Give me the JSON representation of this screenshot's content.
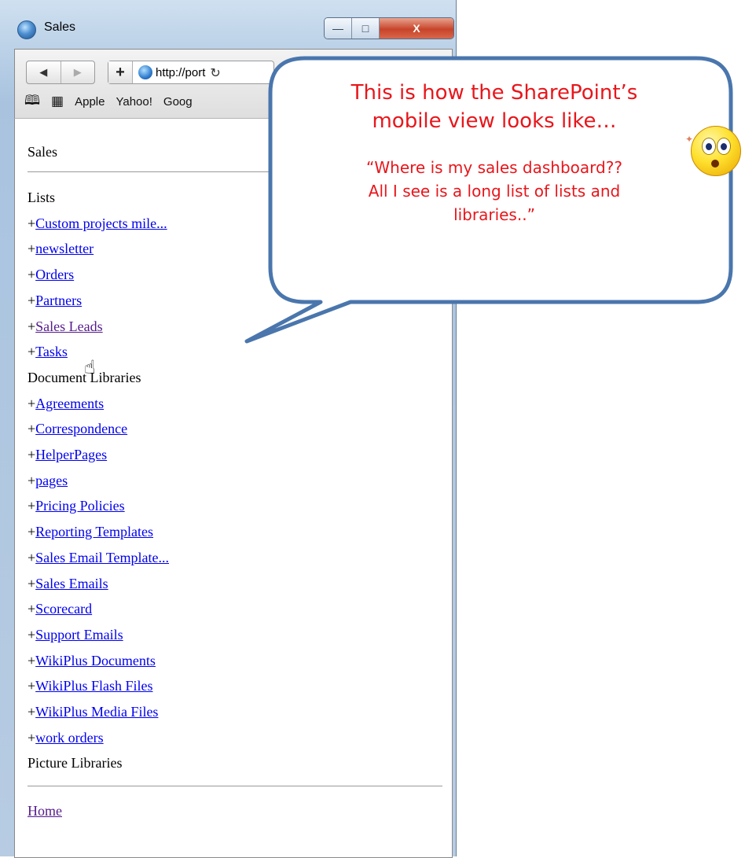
{
  "window": {
    "title": "Sales",
    "controls": {
      "minimize": "—",
      "maximize": "□",
      "close": "X"
    }
  },
  "toolbar": {
    "back": "◀",
    "forward": "▶",
    "add": "+",
    "url": "http://port",
    "reload": "↻",
    "bookmarks": [
      "Apple",
      "Yahoo!",
      "Goog"
    ],
    "bookmark_icons": [
      "book-icon",
      "grid-icon"
    ]
  },
  "page": {
    "site_title": "Sales",
    "lists_heading": "Lists",
    "lists": [
      {
        "prefix": "+",
        "label": "Custom projects mile...",
        "visited": false
      },
      {
        "prefix": "+",
        "label": "newsletter",
        "visited": false
      },
      {
        "prefix": "+",
        "label": "Orders",
        "visited": false
      },
      {
        "prefix": "+",
        "label": "Partners",
        "visited": false
      },
      {
        "prefix": "+",
        "label": "Sales Leads",
        "visited": true
      },
      {
        "prefix": "+",
        "label": "Tasks",
        "visited": false
      }
    ],
    "doclib_heading": "Document Libraries",
    "doclibs": [
      {
        "prefix": "+",
        "label": "Agreements",
        "visited": false
      },
      {
        "prefix": "+",
        "label": "Correspondence",
        "visited": false
      },
      {
        "prefix": "+",
        "label": "HelperPages",
        "visited": false
      },
      {
        "prefix": "+",
        "label": "pages",
        "visited": false
      },
      {
        "prefix": "+",
        "label": "Pricing Policies",
        "visited": false
      },
      {
        "prefix": "+",
        "label": "Reporting Templates",
        "visited": false
      },
      {
        "prefix": "+",
        "label": "Sales Email Template...",
        "visited": false
      },
      {
        "prefix": "+",
        "label": "Sales Emails",
        "visited": false
      },
      {
        "prefix": "+",
        "label": "Scorecard",
        "visited": false
      },
      {
        "prefix": "+",
        "label": "Support Emails",
        "visited": false
      },
      {
        "prefix": "+",
        "label": "WikiPlus Documents",
        "visited": false
      },
      {
        "prefix": "+",
        "label": "WikiPlus Flash Files",
        "visited": false
      },
      {
        "prefix": "+",
        "label": "WikiPlus Media Files",
        "visited": false
      },
      {
        "prefix": "+",
        "label": "work orders",
        "visited": false
      }
    ],
    "piclib_heading": "Picture Libraries",
    "home_link": "Home"
  },
  "callout": {
    "main_line1": "This is how the SharePoint’s",
    "main_line2": "mobile view looks like…",
    "quote_line1": "“Where is my sales dashboard??",
    "quote_line2": "All I see is a long list of lists and",
    "quote_line3": "libraries..”",
    "border_color": "#4a76ad",
    "text_color": "#e8161b"
  }
}
